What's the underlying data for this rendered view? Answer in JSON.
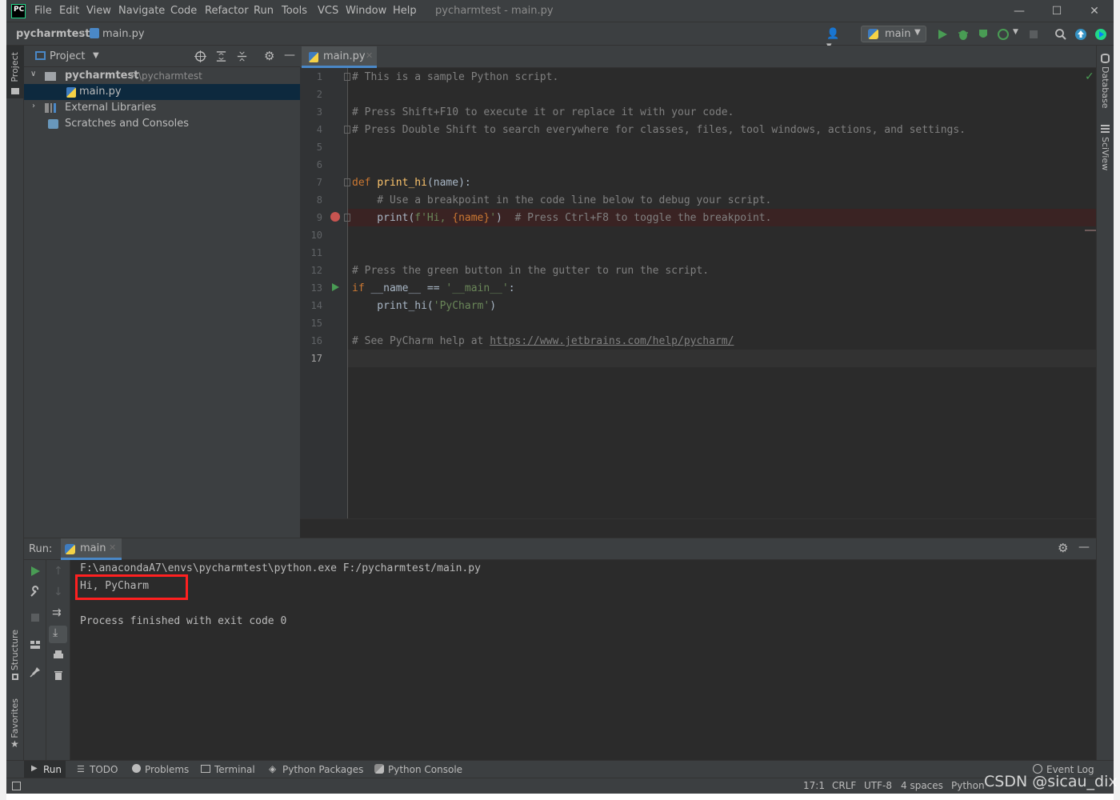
{
  "window": {
    "title": "pycharmtest - main.py",
    "menu": [
      "File",
      "Edit",
      "View",
      "Navigate",
      "Code",
      "Refactor",
      "Run",
      "Tools",
      "VCS",
      "Window",
      "Help"
    ],
    "logo_text": "PC"
  },
  "navbar": {
    "project": "pycharmtest",
    "file": "main.py",
    "run_config": "main"
  },
  "left_stripe": {
    "project": "Project",
    "structure": "Structure",
    "favorites": "Favorites"
  },
  "right_stripe": {
    "database": "Database",
    "sciview": "SciView"
  },
  "project_panel": {
    "title": "Project",
    "tree": [
      {
        "label": "pycharmtest",
        "path": "F:\\pycharmtest"
      },
      {
        "label": "main.py"
      },
      {
        "label": "External Libraries"
      },
      {
        "label": "Scratches and Consoles"
      }
    ]
  },
  "editor": {
    "tab": "main.py",
    "line_numbers": [
      "1",
      "2",
      "3",
      "4",
      "5",
      "6",
      "7",
      "8",
      "9",
      "10",
      "11",
      "12",
      "13",
      "14",
      "15",
      "16",
      "17"
    ],
    "lines": {
      "l1": "# This is a sample Python script.",
      "l3": "# Press Shift+F10 to execute it or replace it with your code.",
      "l4": "# Press Double Shift to search everywhere for classes, files, tool windows, actions, and settings.",
      "l7_kw": "def ",
      "l7_fn": "print_hi",
      "l7_rest": "(name):",
      "l8": "    # Use a breakpoint in the code line below to debug your script.",
      "l9_a": "    print(",
      "l9_b": "f'Hi, ",
      "l9_c": "{name}",
      "l9_d": "'",
      "l9_e": ")  ",
      "l9_f": "# Press Ctrl+F8 to toggle the breakpoint.",
      "l12": "# Press the green button in the gutter to run the script.",
      "l13_kw": "if ",
      "l13_mid": "__name__ == ",
      "l13_str": "'__main__'",
      "l13_end": ":",
      "l14_a": "    print_hi(",
      "l14_b": "'PyCharm'",
      "l14_c": ")",
      "l16_a": "# See PyCharm help at ",
      "l16_link": "https://www.jetbrains.com/help/pycharm/"
    }
  },
  "run_panel": {
    "label": "Run:",
    "tab": "main",
    "output": [
      "F:\\anacondaA7\\envs\\pycharmtest\\python.exe F:/pycharmtest/main.py",
      "Hi, PyCharm",
      "",
      "Process finished with exit code 0"
    ]
  },
  "tool_tabs": [
    "Run",
    "TODO",
    "Problems",
    "Terminal",
    "Python Packages",
    "Python Console"
  ],
  "status": {
    "event_log": "Event Log",
    "position": "17:1",
    "line_sep": "CRLF",
    "encoding": "UTF-8",
    "indent": "4 spaces",
    "interpreter": "Python"
  },
  "watermark": "CSDN @sicau_dix",
  "colors": {
    "accent": "#4a88c7",
    "run_green": "#499c54",
    "breakpoint": "#c75450",
    "highlight": "#ff2020"
  }
}
